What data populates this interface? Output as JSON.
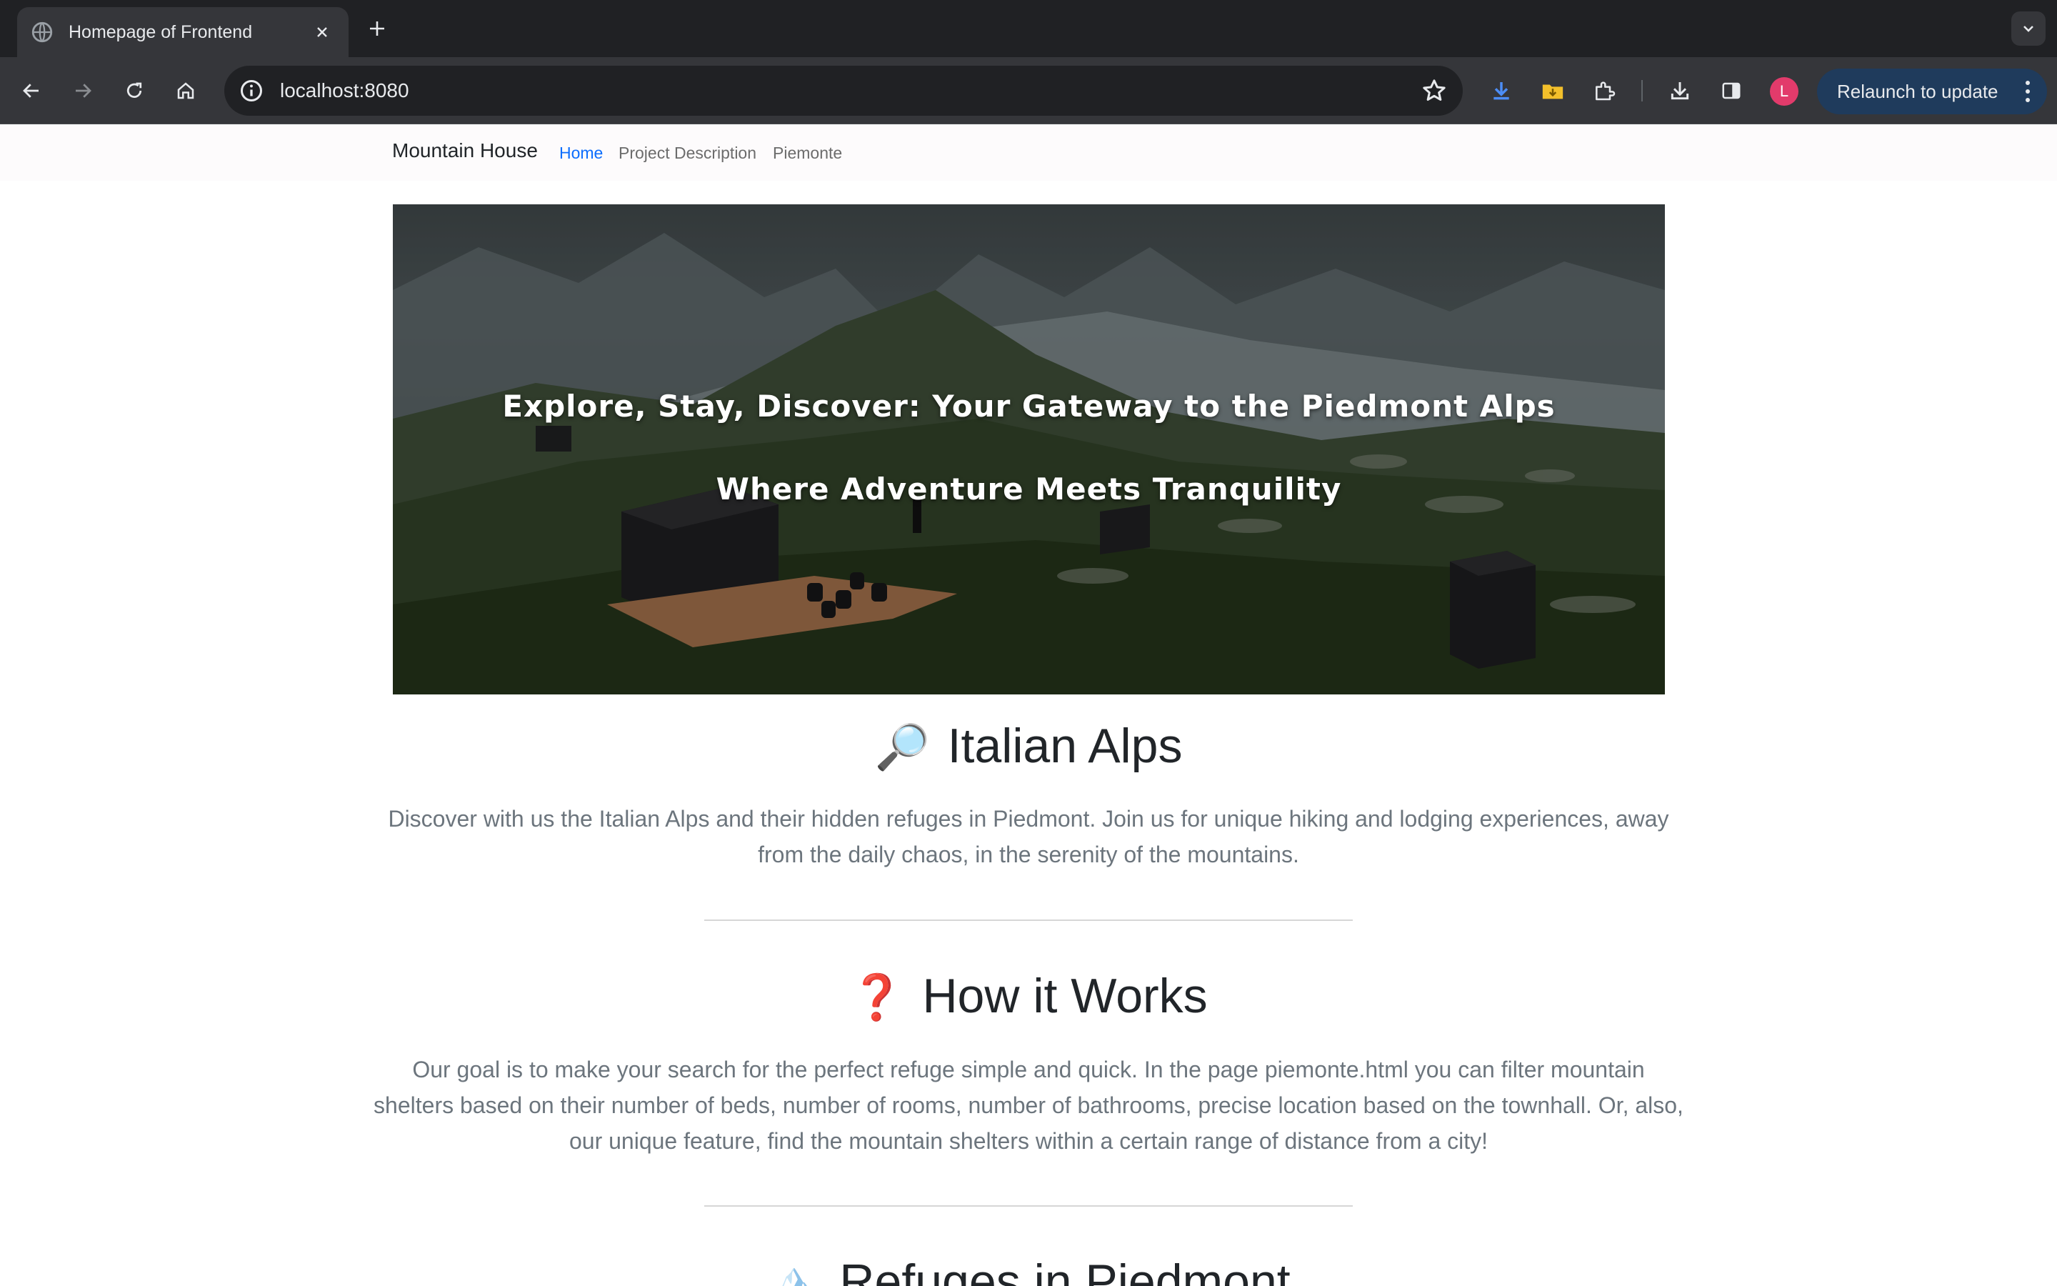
{
  "browser": {
    "tab_title": "Homepage of Frontend",
    "url": "localhost:8080",
    "avatar_letter": "L",
    "relaunch_label": "Relaunch to update"
  },
  "navbar": {
    "brand": "Mountain House",
    "links": [
      "Home",
      "Project Description",
      "Piemonte"
    ]
  },
  "hero": {
    "title": "Explore, Stay, Discover: Your Gateway to the Piedmont Alps",
    "subtitle": "Where Adventure Meets Tranquility"
  },
  "sections": [
    {
      "emoji": "🔎",
      "title": "Italian Alps",
      "text": "Discover with us the Italian Alps and their hidden refuges in Piedmont. Join us for unique hiking and lodging experiences, away from the daily chaos, in the serenity of the mountains."
    },
    {
      "emoji": "❓",
      "title": "How it Works",
      "text": "Our goal is to make your search for the perfect refuge simple and quick. In the page piemonte.html you can filter mountain shelters based on their number of beds, number of rooms, number of bathrooms, precise location based on the townhall. Or, also, our unique feature, find the mountain shelters within a certain range of distance from a city!"
    },
    {
      "emoji": "🏔️",
      "title": "Refuges in Piedmont"
    }
  ],
  "colors": {
    "accent": "#0d6efd",
    "text": "#212529",
    "muted": "#6c757d"
  },
  "icons": [
    "globe-icon",
    "close-icon",
    "plus-icon",
    "chevron-down-icon",
    "back-icon",
    "forward-icon",
    "reload-icon",
    "home-icon",
    "info-icon",
    "star-icon",
    "download-progress-icon",
    "folder-icon",
    "extensions-icon",
    "download-icon",
    "side-panel-icon",
    "more-vert-icon",
    "magnifier-emoji",
    "question-emoji",
    "mountain-emoji"
  ]
}
